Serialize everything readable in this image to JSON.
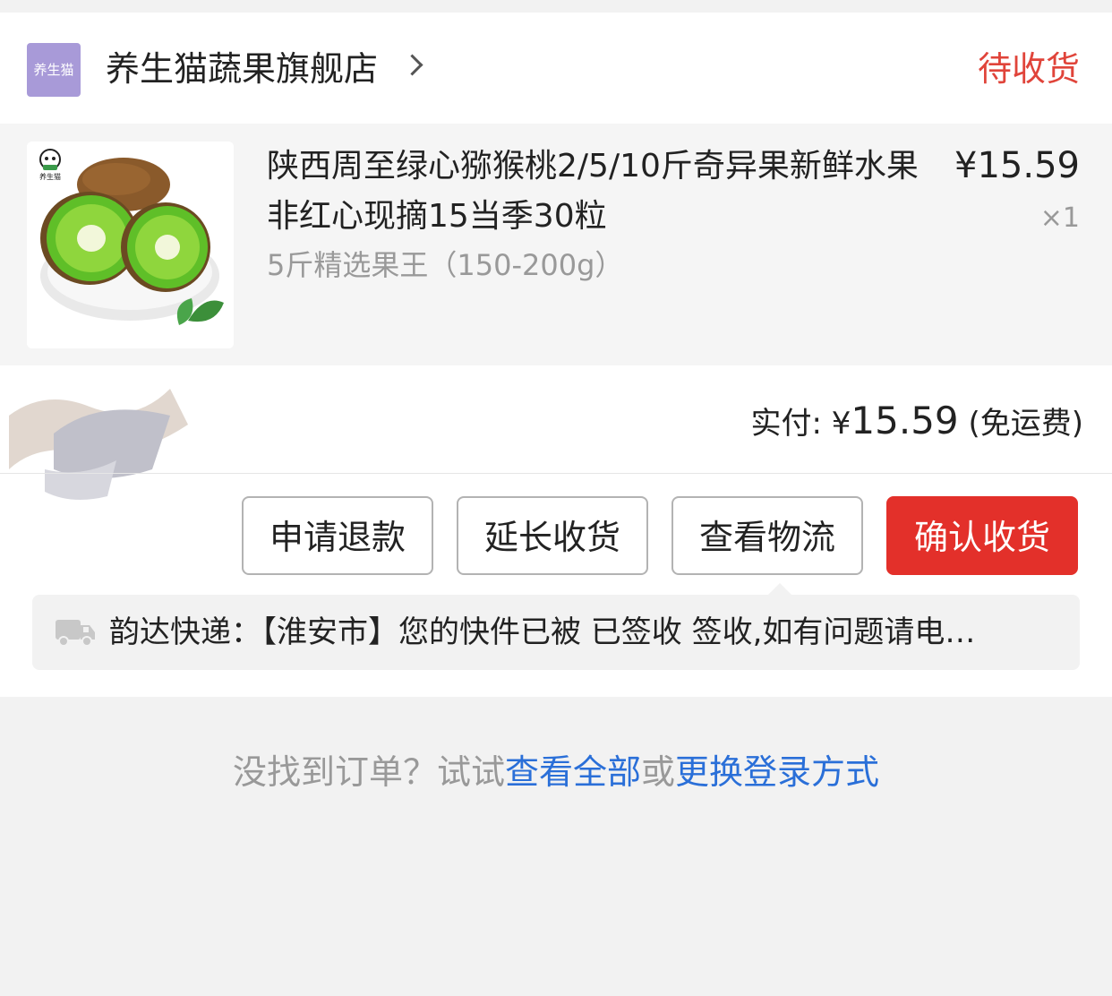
{
  "shop": {
    "logo_text": "养生猫",
    "name": "养生猫蔬果旗舰店",
    "status": "待收货"
  },
  "product": {
    "thumb_logo_text": "养生猫",
    "title": "陕西周至绿心猕猴桃2/5/10斤奇异果新鲜水果非红心现摘15当季30粒",
    "spec": "5斤精选果王（150-200g）",
    "price": "¥15.59",
    "quantity": "×1"
  },
  "payment": {
    "label": "实付: ",
    "currency": "¥",
    "amount": "15.59",
    "note": " (免运费)"
  },
  "actions": {
    "refund": "申请退款",
    "extend": "延长收货",
    "track": "查看物流",
    "confirm": "确认收货"
  },
  "logistics": {
    "carrier": "韵达快递：",
    "message": "【淮安市】您的快件已被  已签收 签收,如有问题请电…",
    "icon": "truck-icon"
  },
  "footer": {
    "prefix": "没找到订单？试试",
    "link_all": "查看全部",
    "middle": "或",
    "link_login": "更换登录方式"
  },
  "colors": {
    "status_red": "#e0443a",
    "confirm_red": "#e3302a",
    "link_blue": "#2a6fd8"
  }
}
